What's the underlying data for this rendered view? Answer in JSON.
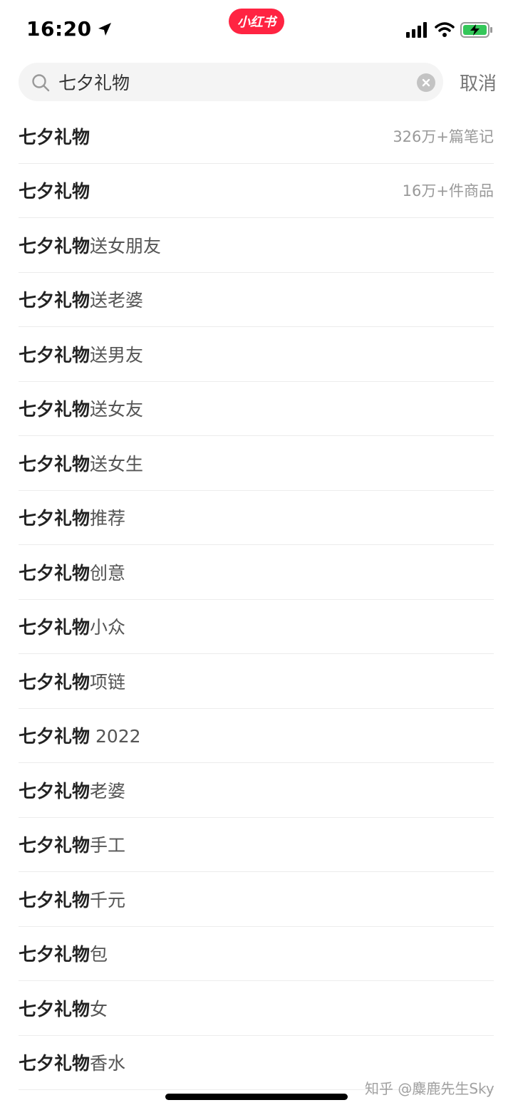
{
  "status_bar": {
    "time": "16:20",
    "app_badge": "小红书",
    "icons": [
      "location-arrow-icon",
      "signal-icon",
      "wifi-icon",
      "battery-charging-icon"
    ],
    "accent_color": "#ff2442"
  },
  "search": {
    "value": "七夕礼物",
    "cancel_label": "取消"
  },
  "results": [
    {
      "keyword": "七夕礼物",
      "suffix": "",
      "count": "326万+篇笔记"
    },
    {
      "keyword": "七夕礼物",
      "suffix": "",
      "count": "16万+件商品"
    },
    {
      "keyword": "七夕礼物",
      "suffix": "送女朋友",
      "count": ""
    },
    {
      "keyword": "七夕礼物",
      "suffix": "送老婆",
      "count": ""
    },
    {
      "keyword": "七夕礼物",
      "suffix": "送男友",
      "count": ""
    },
    {
      "keyword": "七夕礼物",
      "suffix": "送女友",
      "count": ""
    },
    {
      "keyword": "七夕礼物",
      "suffix": "送女生",
      "count": ""
    },
    {
      "keyword": "七夕礼物",
      "suffix": "推荐",
      "count": ""
    },
    {
      "keyword": "七夕礼物",
      "suffix": "创意",
      "count": ""
    },
    {
      "keyword": "七夕礼物",
      "suffix": "小众",
      "count": ""
    },
    {
      "keyword": "七夕礼物",
      "suffix": "项链",
      "count": ""
    },
    {
      "keyword": "七夕礼物",
      "suffix": " 2022",
      "count": ""
    },
    {
      "keyword": "七夕礼物",
      "suffix": "老婆",
      "count": ""
    },
    {
      "keyword": "七夕礼物",
      "suffix": "手工",
      "count": ""
    },
    {
      "keyword": "七夕礼物",
      "suffix": "千元",
      "count": ""
    },
    {
      "keyword": "七夕礼物",
      "suffix": "包",
      "count": ""
    },
    {
      "keyword": "七夕礼物",
      "suffix": "女",
      "count": ""
    },
    {
      "keyword": "七夕礼物",
      "suffix": "香水",
      "count": ""
    }
  ],
  "watermark": "知乎 @麋鹿先生Sky"
}
